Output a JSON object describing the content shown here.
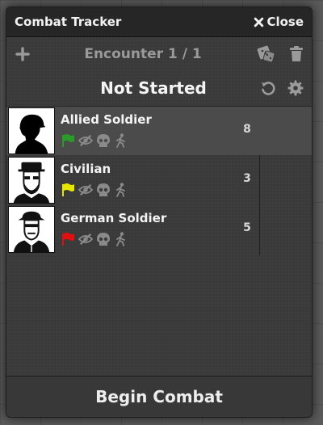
{
  "window": {
    "title": "Combat Tracker",
    "close_label": "Close"
  },
  "encounter": {
    "label": "Encounter 1 / 1",
    "status": "Not Started"
  },
  "combatants": [
    {
      "name": "Allied Soldier",
      "initiative": "8",
      "disposition_color": "#2a9a2a",
      "active": true,
      "portrait": "allied-soldier-silhouette"
    },
    {
      "name": "Civilian",
      "initiative": "3",
      "disposition_color": "#e6e600",
      "active": false,
      "portrait": "civilian-portrait"
    },
    {
      "name": "German Soldier",
      "initiative": "5",
      "disposition_color": "#e01010",
      "active": false,
      "portrait": "german-soldier-portrait"
    }
  ],
  "row_icons": [
    "flag-icon",
    "eye-slash-icon",
    "skull-icon",
    "walking-icon"
  ],
  "header_icons": [
    "plus-icon",
    "dice-icon",
    "trash-icon",
    "undo-icon",
    "gear-icon"
  ],
  "footer": {
    "begin_label": "Begin Combat"
  }
}
